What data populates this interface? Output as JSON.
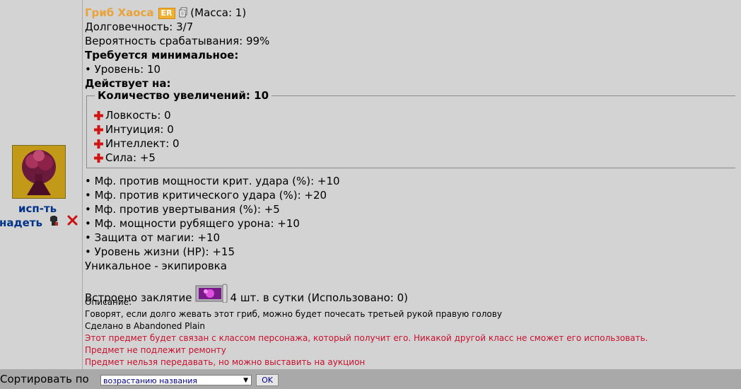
{
  "actions": {
    "use_label": "исп-ть",
    "wear_label": "надеть"
  },
  "item": {
    "name": "Гриб Хаоса",
    "badge": "ER",
    "mass": "(Масса: 1)",
    "durability": "Долговечность: 3/7",
    "trigger_chance": "Вероятность срабатывания: 99%",
    "requires_heading": "Требуется минимальное:",
    "requirements": [
      "• Уровень: 10"
    ],
    "affects_heading": "Действует на:",
    "increments_legend": "Количество увеличений: 10",
    "stat_bonuses": [
      "Ловкость: 0",
      "Интуиция: 0",
      "Интеллект: 0",
      "Сила: +5"
    ],
    "modifiers": [
      "• Мф. против мощности крит. удара (%): +10",
      "• Мф. против критического удара (%): +20",
      "• Мф. против увертывания (%): +5",
      "• Мф. мощности рубящего урона: +10",
      "• Защита от магии: +10",
      "• Уровень жизни (HP): +15"
    ],
    "unique_note": "Уникальное - экипировка",
    "spell_prefix": "Встроено заклятие",
    "spell_suffix": "4 шт. в сутки (Использовано: 0)",
    "description_heading": "Описание:",
    "description": "Говорят, если долго жевать этот гриб, можно будет почесать третьей рукой правую голову",
    "made_in": "Сделано в Abandoned Plain",
    "warnings": [
      "Этот предмет будет связан с классом персонажа, который получит его. Никакой другой класс не сможет его использовать.",
      "Предмет не подлежит ремонту",
      "Предмет нельзя передавать, но можно выставить на аукцион"
    ]
  },
  "sort": {
    "label": "Сортировать по",
    "selected": "возрастанию названия",
    "ok_label": "OK"
  },
  "colors": {
    "item_name": "#e8a33a",
    "warning": "#c8102e",
    "action_link": "#003388",
    "background": "#d3d3d3"
  },
  "icons": [
    "item-thumbnail",
    "copy-icon",
    "wear-icon",
    "delete-icon",
    "plus-icon",
    "spell-scroll-icon",
    "dropdown-arrow-icon"
  ]
}
